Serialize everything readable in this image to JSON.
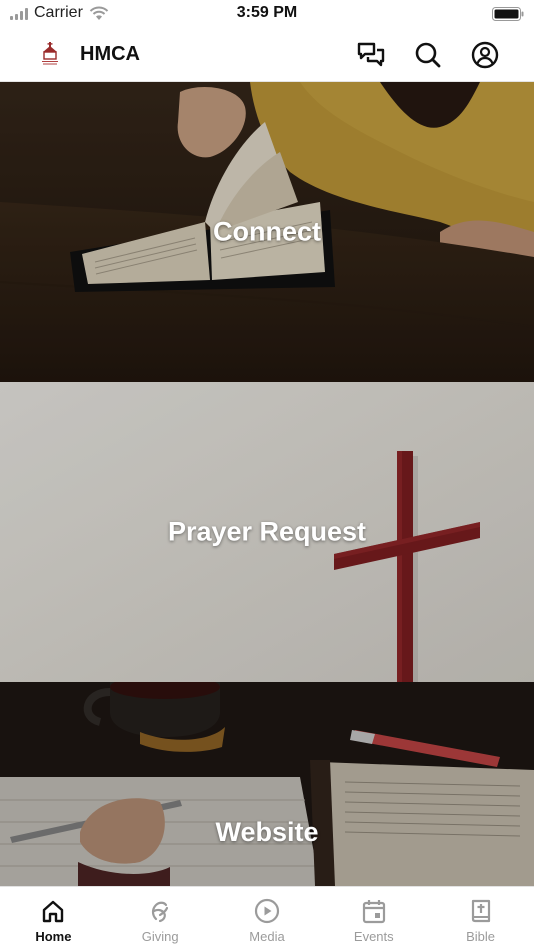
{
  "status_bar": {
    "carrier": "Carrier",
    "time": "3:59 PM"
  },
  "header": {
    "title": "HMCA",
    "icons": [
      "chat-icon",
      "search-icon",
      "account-icon"
    ]
  },
  "tiles": [
    {
      "label": "Connect",
      "image": "open-bible-on-table"
    },
    {
      "label": "Prayer Request",
      "image": "red-wooden-cross"
    },
    {
      "label": "Website",
      "image": "notebook-pen-and-bible"
    }
  ],
  "tab_bar": {
    "items": [
      {
        "label": "Home",
        "icon": "home-icon",
        "active": true
      },
      {
        "label": "Giving",
        "icon": "giving-icon",
        "active": false
      },
      {
        "label": "Media",
        "icon": "play-icon",
        "active": false
      },
      {
        "label": "Events",
        "icon": "calendar-icon",
        "active": false
      },
      {
        "label": "Bible",
        "icon": "bible-icon",
        "active": false
      }
    ]
  },
  "colors": {
    "active_tab": "#111111",
    "inactive_tab": "#9b9b9b",
    "tile_text": "#ffffff",
    "cross": "#6e1a1c"
  }
}
